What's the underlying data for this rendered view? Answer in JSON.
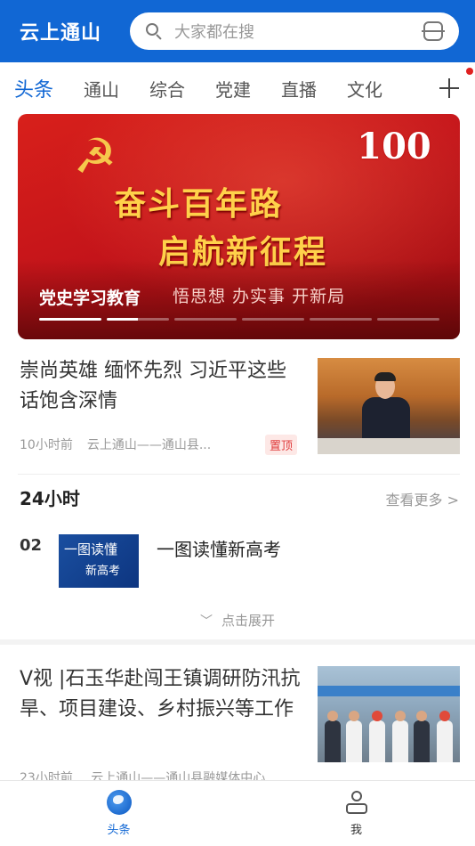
{
  "header": {
    "title": "云上通山",
    "search_placeholder": "大家都在搜"
  },
  "tabs": [
    "头条",
    "通山",
    "综合",
    "党建",
    "直播",
    "文化"
  ],
  "banner": {
    "slogan_line1": "奋斗百年路",
    "slogan_line2": "启航新征程",
    "anniversary_number": "100",
    "subtitle": "悟思想  办实事  开新局",
    "caption": "党史学习教育"
  },
  "news1": {
    "title": "崇尚英雄 缅怀先烈 习近平这些话饱含深情",
    "time": "10小时前",
    "source": "云上通山——通山县...",
    "badge": "置顶"
  },
  "hot24": {
    "title": "24小时",
    "more": "查看更多 >",
    "item": {
      "rank": "02",
      "thumb_line1": "一图读懂",
      "thumb_line2": "新高考",
      "title": "一图读懂新高考"
    },
    "expand": "点击展开"
  },
  "news2": {
    "title": "V视 |石玉华赴闯王镇调研防汛抗旱、项目建设、乡村振兴等工作",
    "time": "23小时前",
    "source": "云上通山——通山县融媒体中心"
  },
  "bottom_nav": {
    "home_label": "头条",
    "me_label": "我"
  },
  "colors": {
    "brand_blue": "#1167d4",
    "banner_red": "#c4141a",
    "badge_red": "#e03c3c"
  }
}
